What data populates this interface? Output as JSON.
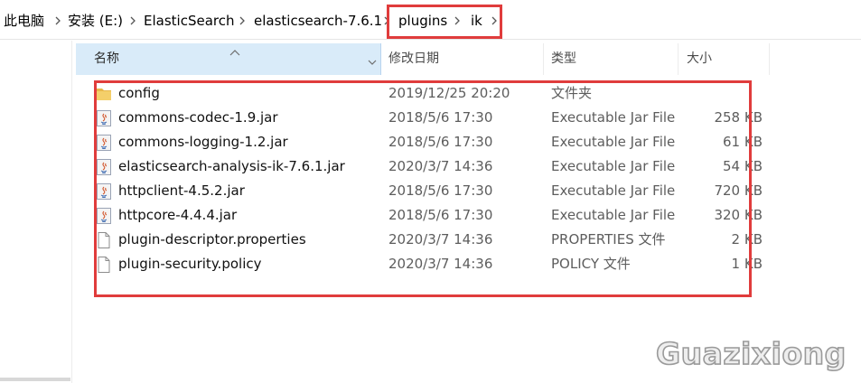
{
  "breadcrumb": [
    {
      "label": "此电脑"
    },
    {
      "label": "安装 (E:)"
    },
    {
      "label": "ElasticSearch"
    },
    {
      "label": "elasticsearch-7.6.1"
    },
    {
      "label": "plugins"
    },
    {
      "label": "ik"
    }
  ],
  "columns": {
    "name": "名称",
    "date": "修改日期",
    "type": "类型",
    "size": "大小"
  },
  "files": [
    {
      "icon": "folder-icon",
      "name": "config",
      "date": "2019/12/25 20:20",
      "type": "文件夹",
      "size": ""
    },
    {
      "icon": "java-jar-icon",
      "name": "commons-codec-1.9.jar",
      "date": "2018/5/6 17:30",
      "type": "Executable Jar File",
      "size": "258 KB"
    },
    {
      "icon": "java-jar-icon",
      "name": "commons-logging-1.2.jar",
      "date": "2018/5/6 17:30",
      "type": "Executable Jar File",
      "size": "61 KB"
    },
    {
      "icon": "java-jar-icon",
      "name": "elasticsearch-analysis-ik-7.6.1.jar",
      "date": "2020/3/7 14:36",
      "type": "Executable Jar File",
      "size": "54 KB"
    },
    {
      "icon": "java-jar-icon",
      "name": "httpclient-4.5.2.jar",
      "date": "2018/5/6 17:30",
      "type": "Executable Jar File",
      "size": "720 KB"
    },
    {
      "icon": "java-jar-icon",
      "name": "httpcore-4.4.4.jar",
      "date": "2018/5/6 17:30",
      "type": "Executable Jar File",
      "size": "320 KB"
    },
    {
      "icon": "document-icon",
      "name": "plugin-descriptor.properties",
      "date": "2020/3/7 14:36",
      "type": "PROPERTIES 文件",
      "size": "2 KB"
    },
    {
      "icon": "document-icon",
      "name": "plugin-security.policy",
      "date": "2020/3/7 14:36",
      "type": "POLICY 文件",
      "size": "1 KB"
    }
  ],
  "watermark": "Guazixiong",
  "colors": {
    "highlight": "#e03c3c",
    "header_selected": "#d9ebf9",
    "folder": "#e8b84a"
  }
}
